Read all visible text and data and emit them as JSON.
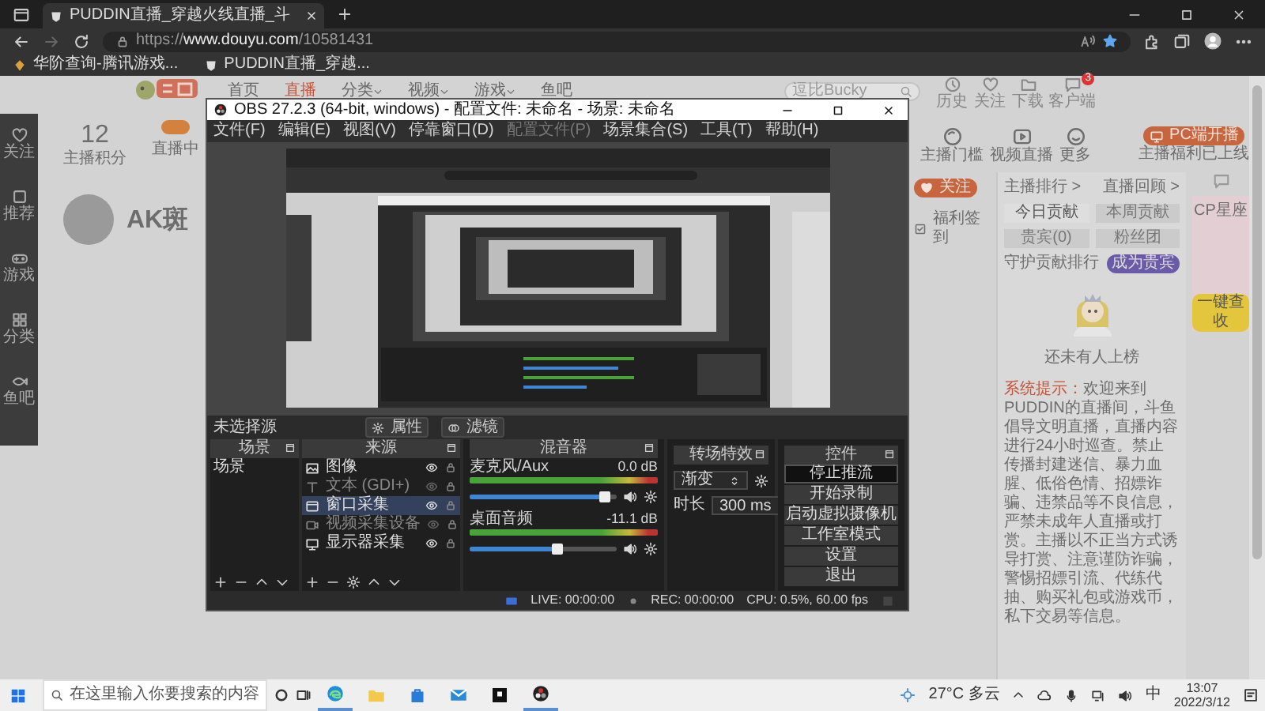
{
  "browser": {
    "tab_title": "PUDDIN直播_穿越火线直播_斗",
    "url": {
      "scheme": "https://",
      "domain": "www.douyu.com",
      "path": "/10581431"
    },
    "bookmarks": [
      "华阶查询-腾讯游戏...",
      "PUDDIN直播_穿越..."
    ]
  },
  "site": {
    "nav": [
      {
        "label": "首页",
        "selected": false,
        "dropdown": false
      },
      {
        "label": "直播",
        "selected": true,
        "dropdown": false
      },
      {
        "label": "分类",
        "selected": false,
        "dropdown": true
      },
      {
        "label": "视频",
        "selected": false,
        "dropdown": true
      },
      {
        "label": "游戏",
        "selected": false,
        "dropdown": true
      },
      {
        "label": "鱼吧",
        "selected": false,
        "dropdown": false
      }
    ],
    "search_placeholder": "逗比Bucky",
    "header_icons": [
      {
        "label": "历史",
        "kind": "clock"
      },
      {
        "label": "关注",
        "kind": "heart"
      },
      {
        "label": "下载",
        "kind": "folder"
      },
      {
        "label": "客户端",
        "kind": "chat",
        "badge": "3"
      }
    ],
    "sidebar": [
      {
        "label": "关注",
        "kind": "heart"
      },
      {
        "label": "推荐",
        "kind": "square"
      },
      {
        "label": "游戏",
        "kind": "gamepad"
      },
      {
        "label": "分类",
        "kind": "grid"
      },
      {
        "label": "鱼吧",
        "kind": "fish"
      }
    ],
    "room": {
      "score": "12",
      "score_label": "主播积分",
      "live_label": "直播中",
      "live": true,
      "streamer": "AK斑"
    },
    "tools": [
      {
        "label": "主播门槛",
        "kind": "ring"
      },
      {
        "label": "视频直播",
        "kind": "play"
      },
      {
        "label": "更多",
        "kind": "smile"
      }
    ],
    "pc_button": "PC端开播",
    "pc_note": "主播福利已上线",
    "follow_button": "关注",
    "checkin": "福利签到",
    "rank_links": [
      "主播排行 >",
      "直播回顾 >"
    ],
    "rank_tabs": [
      {
        "label": "今日贡献",
        "selected": true
      },
      {
        "label": "本周贡献",
        "selected": false
      },
      {
        "label": "贵宾(0)",
        "selected": false
      },
      {
        "label": "粉丝团",
        "selected": false
      }
    ],
    "rank_title": "守护贡献排行",
    "vip_button": "成为贵宾",
    "empty_text": "还未有人上榜",
    "notice_label": "系统提示：",
    "notice_text": "欢迎来到PUDDIN的直播间，斗鱼倡导文明直播，直播内容进行24小时巡查。禁止传播封建迷信、暴力血腥、低俗色情、招嫖诈骗、违禁品等不良信息，严禁未成年人直播或打赏。主播以不正当方式诱导打赏、注意谨防诈骗，警惕招嫖引流、代练代抽、购买礼包或游戏币，私下交易等信息。",
    "ad_title": "CP星座",
    "ad_button": "一键查收"
  },
  "obs": {
    "title": "OBS 27.2.3 (64-bit, windows) - 配置文件: 未命名 - 场景: 未命名",
    "menu": [
      {
        "label": "文件(F)",
        "disabled": false
      },
      {
        "label": "编辑(E)",
        "disabled": false
      },
      {
        "label": "视图(V)",
        "disabled": false
      },
      {
        "label": "停靠窗口(D)",
        "disabled": false
      },
      {
        "label": "配置文件(P)",
        "disabled": true
      },
      {
        "label": "场景集合(S)",
        "disabled": false
      },
      {
        "label": "工具(T)",
        "disabled": false
      },
      {
        "label": "帮助(H)",
        "disabled": false
      }
    ],
    "source_status": "未选择源",
    "toolbar_buttons": [
      {
        "label": "属性",
        "kind": "gear"
      },
      {
        "label": "滤镜",
        "kind": "filter"
      }
    ],
    "docks": {
      "scenes": "场景",
      "sources": "来源",
      "mixer": "混音器",
      "transitions": "转场特效",
      "controls": "控件"
    },
    "scenes": [
      {
        "label": "场景",
        "selected": false
      }
    ],
    "sources": [
      {
        "label": "图像",
        "kind": "image",
        "visible": true,
        "selected": false
      },
      {
        "label": "文本 (GDI+)",
        "kind": "text",
        "visible": false,
        "selected": false
      },
      {
        "label": "窗口采集",
        "kind": "window",
        "visible": true,
        "selected": true
      },
      {
        "label": "视频采集设备",
        "kind": "camera",
        "visible": false,
        "selected": false
      },
      {
        "label": "显示器采集",
        "kind": "monitor",
        "visible": true,
        "selected": false
      }
    ],
    "mixer": [
      {
        "name": "麦克风/Aux",
        "reading": "0.0 dB",
        "level": 0.93
      },
      {
        "name": "桌面音频",
        "reading": "-11.1 dB",
        "level": 0.6
      }
    ],
    "transition": {
      "value": "渐变",
      "duration_label": "时长",
      "duration": "300 ms"
    },
    "controls": [
      {
        "label": "停止推流",
        "active": true
      },
      {
        "label": "开始录制",
        "active": false
      },
      {
        "label": "启动虚拟摄像机",
        "active": false
      },
      {
        "label": "工作室模式",
        "active": false
      },
      {
        "label": "设置",
        "active": false
      },
      {
        "label": "退出",
        "active": false
      }
    ],
    "status": {
      "live": "LIVE: 00:00:00",
      "rec": "REC: 00:00:00",
      "cpu": "CPU: 0.5%, 60.00 fps"
    }
  },
  "taskbar": {
    "search_placeholder": "在这里输入你要搜索的内容",
    "apps": [
      {
        "kind": "edge",
        "running": true
      },
      {
        "kind": "explorer",
        "running": false
      },
      {
        "kind": "store",
        "running": false
      },
      {
        "kind": "mail",
        "running": false
      },
      {
        "kind": "terminal",
        "running": false
      },
      {
        "kind": "obs",
        "running": true
      }
    ],
    "weather": "27°C 多云",
    "ime": "中",
    "time": "13:07",
    "date": "2022/3/12"
  }
}
